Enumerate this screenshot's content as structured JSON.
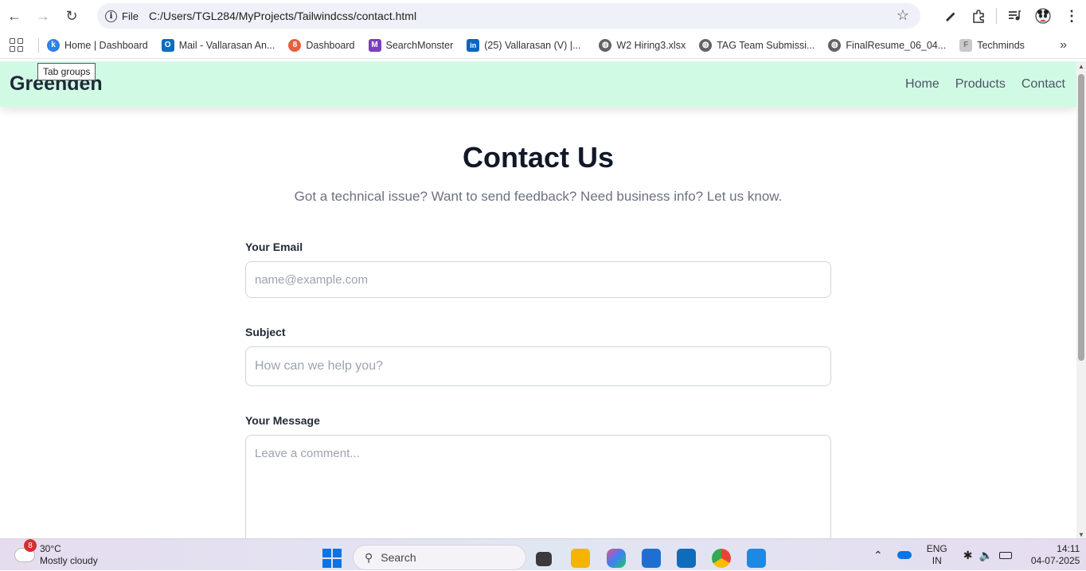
{
  "browser": {
    "back_icon": "back-arrow-icon",
    "forward_icon": "forward-arrow-icon",
    "reload_icon": "reload-icon",
    "chip_label": "File",
    "url": "C:/Users/TGL284/MyProjects/Tailwindcss/contact.html",
    "tooltip": "Tab groups"
  },
  "bookmarks": [
    {
      "label": "Home | Dashboard",
      "color": "#2f80ed",
      "glyph": "k"
    },
    {
      "label": "Mail - Vallarasan An...",
      "color": "#0f6cbd",
      "glyph": "O"
    },
    {
      "label": "Dashboard",
      "color": "#e85d3f",
      "glyph": "8"
    },
    {
      "label": "SearchMonster",
      "color": "#7b3fbf",
      "glyph": "M"
    },
    {
      "label": "(25) Vallarasan (V) |...",
      "color": "#0a66c2",
      "glyph": "in"
    },
    {
      "label": "W2 Hiring3.xlsx",
      "color": "#5f6368",
      "glyph": "◍"
    },
    {
      "label": "TAG Team Submissi...",
      "color": "#5f6368",
      "glyph": "◍"
    },
    {
      "label": "FinalResume_06_04...",
      "color": "#5f6368",
      "glyph": "◍"
    },
    {
      "label": "Techminds",
      "color": "#c9c9c9",
      "glyph": "F"
    }
  ],
  "site": {
    "brand": "Greenden",
    "nav": [
      "Home",
      "Products",
      "Contact"
    ]
  },
  "contact": {
    "title": "Contact Us",
    "subtitle": "Got a technical issue? Want to send feedback? Need business info? Let us know.",
    "email_label": "Your Email",
    "email_placeholder": "name@example.com",
    "subject_label": "Subject",
    "subject_placeholder": "How can we help you?",
    "message_label": "Your Message",
    "message_placeholder": "Leave a comment..."
  },
  "taskbar": {
    "weather_badge": "8",
    "temperature": "30°C",
    "condition": "Mostly cloudy",
    "search": "Search",
    "lang_top": "ENG",
    "lang_bottom": "IN",
    "time": "14:11",
    "date": "04-07-2025"
  }
}
